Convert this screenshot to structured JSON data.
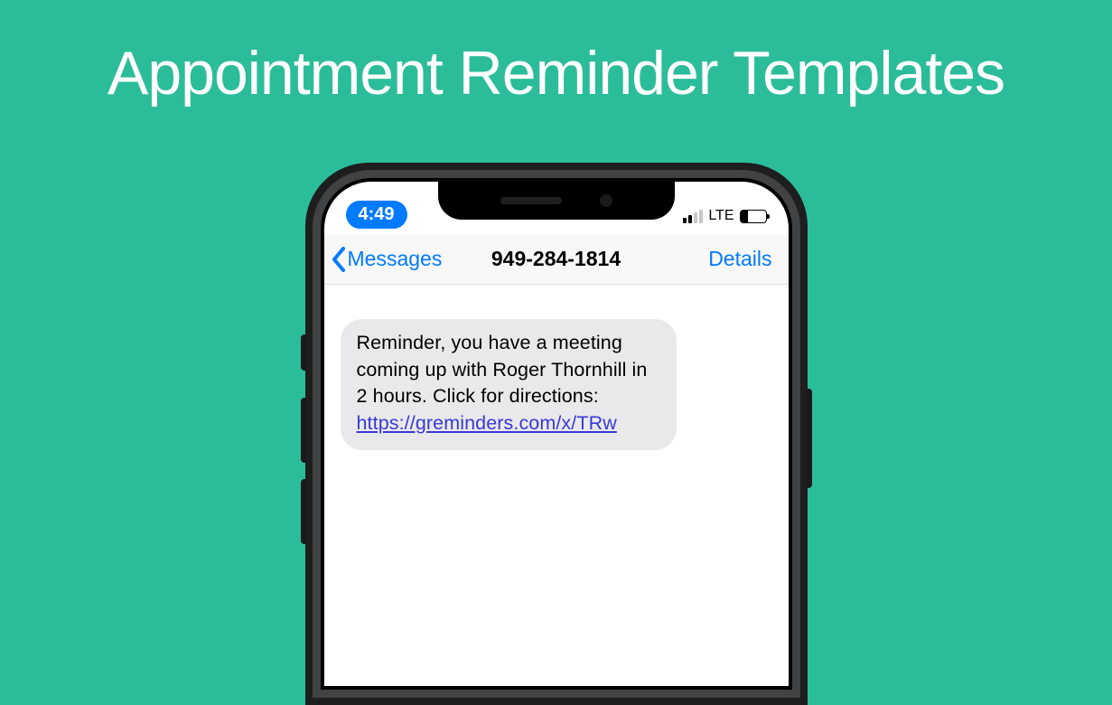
{
  "title": "Appointment Reminder Templates",
  "status": {
    "time": "4:49",
    "network": "LTE"
  },
  "nav": {
    "back_label": "Messages",
    "contact": "949-284-1814",
    "details_label": "Details"
  },
  "message": {
    "text": "Reminder, you have a meeting coming up with Roger Thornhill in 2 hours. Click for directions: ",
    "link": "https://greminders.com/x/TRw"
  }
}
